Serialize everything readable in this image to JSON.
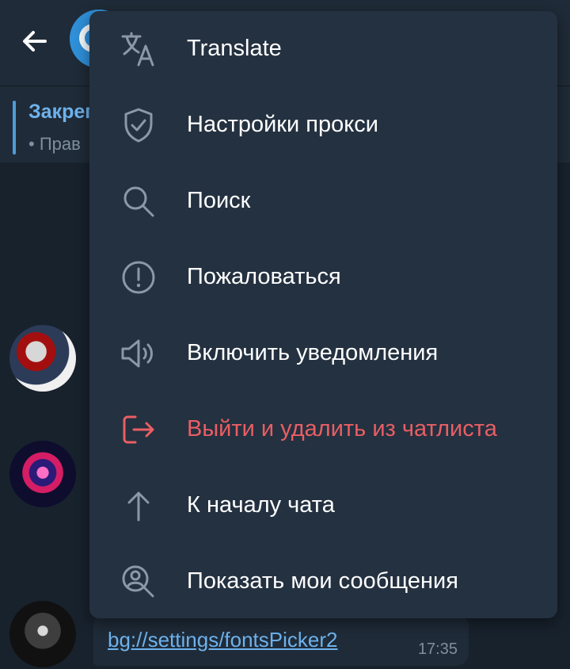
{
  "header": {
    "pinned_title": "Закреп",
    "pinned_text": "• Прав"
  },
  "menu": {
    "items": [
      {
        "label": "Translate",
        "icon": "translate-icon"
      },
      {
        "label": "Настройки прокси",
        "icon": "shield-icon"
      },
      {
        "label": "Поиск",
        "icon": "search-icon"
      },
      {
        "label": "Пожаловаться",
        "icon": "report-icon"
      },
      {
        "label": "Включить уведомления",
        "icon": "speaker-icon"
      },
      {
        "label": "Выйти и удалить из чатлиста",
        "icon": "leave-icon",
        "color": "#ea5e64"
      },
      {
        "label": "К началу чата",
        "icon": "arrow-up-icon"
      },
      {
        "label": "Показать мои сообщения",
        "icon": "user-search-icon"
      }
    ]
  },
  "message": {
    "link": "bg://settings/fontsPicker2",
    "time": "17:35"
  },
  "colors": {
    "menu_bg": "#243140",
    "chat_bg": "#18222d",
    "header_bg": "#1f2b38",
    "accent": "#6eb2ec",
    "danger": "#ea5e64",
    "icon": "#8b98a6"
  }
}
